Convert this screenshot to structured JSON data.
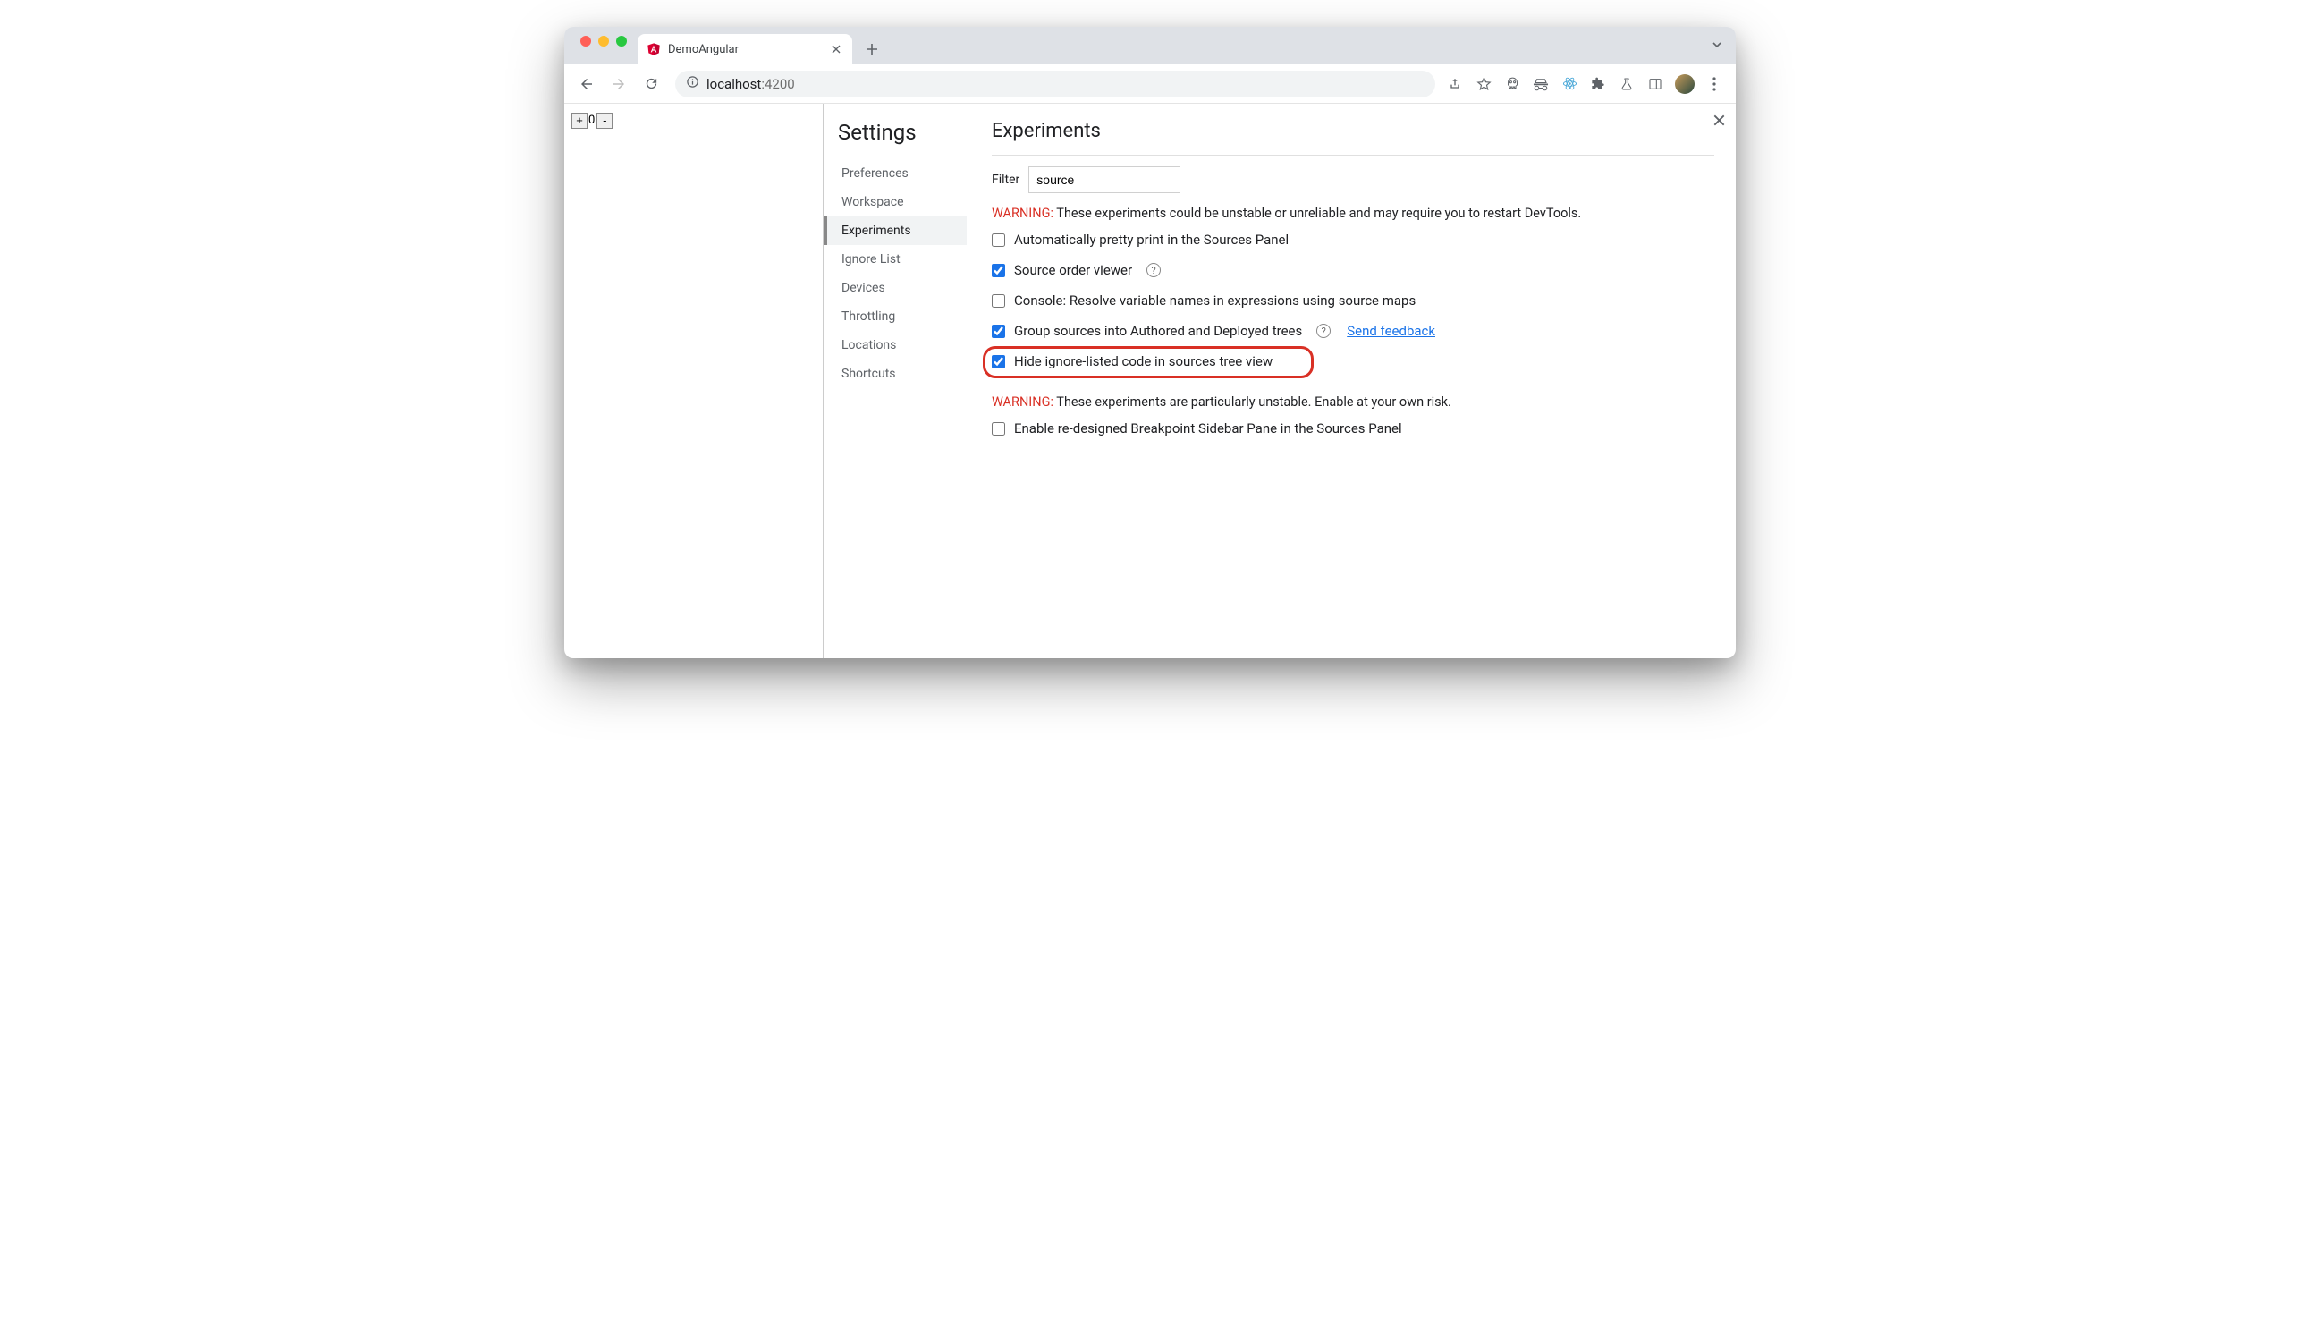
{
  "browser": {
    "tab_title": "DemoAngular",
    "url_host": "localhost",
    "url_port": ":4200"
  },
  "page": {
    "counter_value": "0"
  },
  "settings": {
    "title": "Settings",
    "nav": [
      {
        "label": "Preferences",
        "active": false
      },
      {
        "label": "Workspace",
        "active": false
      },
      {
        "label": "Experiments",
        "active": true
      },
      {
        "label": "Ignore List",
        "active": false
      },
      {
        "label": "Devices",
        "active": false
      },
      {
        "label": "Throttling",
        "active": false
      },
      {
        "label": "Locations",
        "active": false
      },
      {
        "label": "Shortcuts",
        "active": false
      }
    ]
  },
  "experiments": {
    "heading": "Experiments",
    "filter_label": "Filter",
    "filter_value": "source",
    "warning1_label": "WARNING:",
    "warning1_text": " These experiments could be unstable or unreliable and may require you to restart DevTools.",
    "warning2_label": "WARNING:",
    "warning2_text": " These experiments are particularly unstable. Enable at your own risk.",
    "feedback_link": "Send feedback",
    "items": [
      {
        "label": "Automatically pretty print in the Sources Panel",
        "checked": false,
        "help": false
      },
      {
        "label": "Source order viewer",
        "checked": true,
        "help": true
      },
      {
        "label": "Console: Resolve variable names in expressions using source maps",
        "checked": false,
        "help": false
      },
      {
        "label": "Group sources into Authored and Deployed trees",
        "checked": true,
        "help": true,
        "feedback": true
      },
      {
        "label": "Hide ignore-listed code in sources tree view",
        "checked": true,
        "help": false,
        "highlighted": true
      }
    ],
    "items2": [
      {
        "label": "Enable re-designed Breakpoint Sidebar Pane in the Sources Panel",
        "checked": false
      }
    ]
  }
}
